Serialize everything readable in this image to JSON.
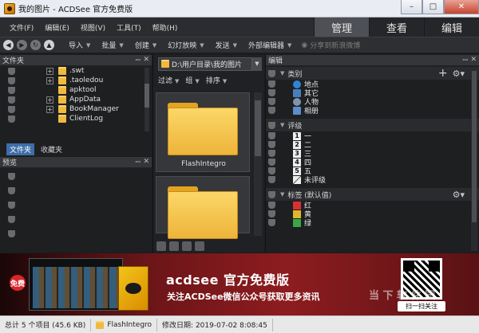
{
  "window": {
    "title": "我的图片 - ACDSee 官方免费版",
    "min": "–",
    "max": "□",
    "close": "✕"
  },
  "menu": [
    {
      "label": "文件(F)"
    },
    {
      "label": "编辑(E)"
    },
    {
      "label": "视图(V)"
    },
    {
      "label": "工具(T)"
    },
    {
      "label": "帮助(H)"
    }
  ],
  "modes": [
    {
      "label": "管理",
      "active": true
    },
    {
      "label": "查看",
      "active": false
    },
    {
      "label": "编辑",
      "active": false
    }
  ],
  "toolbar": {
    "items": [
      {
        "label": "导入"
      },
      {
        "label": "批量"
      },
      {
        "label": "创建"
      },
      {
        "label": "幻灯放映"
      },
      {
        "label": "发送"
      },
      {
        "label": "外部编辑器"
      }
    ],
    "share": "分享到新浪微博"
  },
  "folders": {
    "title": "文件夹",
    "items": [
      {
        "name": ".swt",
        "expand": "+"
      },
      {
        "name": ".taoledou",
        "expand": "+"
      },
      {
        "name": "apktool",
        "expand": ""
      },
      {
        "name": "AppData",
        "expand": "+"
      },
      {
        "name": "BookManager",
        "expand": "+"
      },
      {
        "name": "ClientLog",
        "expand": ""
      }
    ],
    "tabs": [
      {
        "label": "文件夹",
        "active": true
      },
      {
        "label": "收藏夹",
        "active": false
      }
    ]
  },
  "preview": {
    "title": "预览"
  },
  "files": {
    "path": "D:\\用户目录\\我的图片",
    "view": [
      {
        "label": "过滤"
      },
      {
        "label": "组"
      },
      {
        "label": "排序"
      }
    ],
    "items": [
      {
        "name": "FlashIntegro"
      },
      {
        "name": ""
      }
    ]
  },
  "props": {
    "title": "编辑",
    "categories": {
      "title": "类别",
      "items": [
        {
          "label": "地点",
          "color": "#2e86d1"
        },
        {
          "label": "其它",
          "color": "#4a7fbd"
        },
        {
          "label": "人物",
          "color": "#7f93ad"
        },
        {
          "label": "相册",
          "color": "#5d8dc9"
        }
      ]
    },
    "ratings": {
      "title": "评级",
      "items": [
        {
          "num": "1",
          "label": "一"
        },
        {
          "num": "2",
          "label": "二"
        },
        {
          "num": "3",
          "label": "三"
        },
        {
          "num": "4",
          "label": "四"
        },
        {
          "num": "5",
          "label": "五"
        },
        {
          "num": "",
          "label": "未评级"
        }
      ]
    },
    "tags": {
      "title": "标签 (默认值)",
      "items": [
        {
          "label": "红",
          "color": "#d93131"
        },
        {
          "label": "黄",
          "color": "#e3b62a"
        },
        {
          "label": "绿",
          "color": "#3aa745"
        }
      ]
    }
  },
  "banner": {
    "badge": "免费",
    "title": "acdsee 官方免费版",
    "subtitle": "关注ACDSee微信公众号获取更多资讯",
    "qr_label": "扫一扫关注",
    "watermark": "当 下 软 件 园"
  },
  "status": {
    "total": "总计 5 个项目 (45.6 KB)",
    "selected": "FlashIntegro",
    "modified": "修改日期: 2019-07-02 8:08:45"
  }
}
